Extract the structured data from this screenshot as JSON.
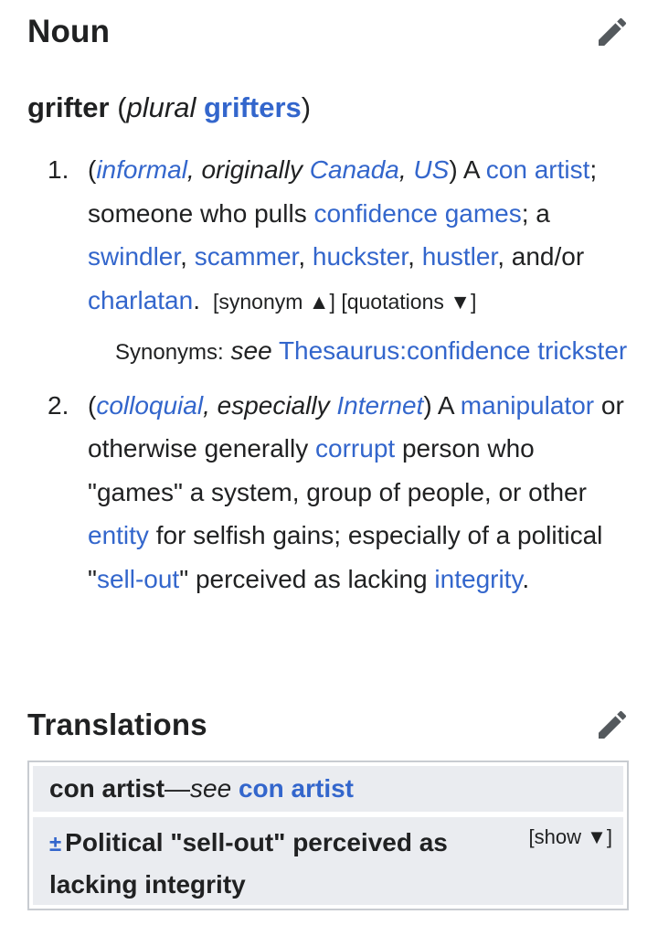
{
  "noun_heading": "Noun",
  "headword": {
    "word": "grifter",
    "open": " (",
    "plural_label": "plural",
    "plural_form": "grifters",
    "close": ")"
  },
  "senses": [
    {
      "number": "1.",
      "parts": [
        {
          "t": "("
        },
        {
          "t": "informal",
          "link": true,
          "italic": true
        },
        {
          "t": ", originally ",
          "italic": true
        },
        {
          "t": "Canada",
          "link": true,
          "italic": true
        },
        {
          "t": ", ",
          "italic": true
        },
        {
          "t": "US",
          "link": true,
          "italic": true
        },
        {
          "t": ") A "
        },
        {
          "t": "con artist",
          "link": true
        },
        {
          "t": "; someone who pulls "
        },
        {
          "t": "confidence games",
          "link": true
        },
        {
          "t": "; a "
        },
        {
          "t": "swindler",
          "link": true
        },
        {
          "t": ", "
        },
        {
          "t": "scammer",
          "link": true
        },
        {
          "t": ", "
        },
        {
          "t": "huckster",
          "link": true
        },
        {
          "t": ", "
        },
        {
          "t": "hustler",
          "link": true
        },
        {
          "t": ", and/or "
        },
        {
          "t": "charlatan",
          "link": true
        },
        {
          "t": "."
        }
      ],
      "synonym_toggle": "[synonym ▲]",
      "quotations_toggle": "[quotations ▼]",
      "synonyms_label": "Synonyms:",
      "synonyms_see": "see",
      "synonyms_link": "Thesaurus:confidence trickster"
    },
    {
      "number": "2.",
      "parts": [
        {
          "t": "("
        },
        {
          "t": "colloquial",
          "link": true,
          "italic": true
        },
        {
          "t": ", especially ",
          "italic": true
        },
        {
          "t": "Internet",
          "link": true,
          "italic": true
        },
        {
          "t": ") A "
        },
        {
          "t": "manipulator",
          "link": true
        },
        {
          "t": " or otherwise generally "
        },
        {
          "t": "corrupt",
          "link": true
        },
        {
          "t": " person who \"games\" a system, group of people, or other "
        },
        {
          "t": "entity",
          "link": true
        },
        {
          "t": " for selfish gains; especially of a political \""
        },
        {
          "t": "sell-out",
          "link": true
        },
        {
          "t": "\" perceived as lacking "
        },
        {
          "t": "integrity",
          "link": true
        },
        {
          "t": "."
        }
      ]
    }
  ],
  "translations_heading": "Translations",
  "translations": {
    "row1_term": "con artist",
    "row1_dash": " — ",
    "row1_see": "see",
    "row1_link": "con artist",
    "row2_marker": "±",
    "row2_title": "Political \"sell-out\" perceived as lacking integrity",
    "row2_toggle": "[show ▼]"
  },
  "icons": {
    "edit": "pencil-icon"
  },
  "colors": {
    "link": "#3366cc",
    "text": "#202122",
    "box_bg": "#eaecf0",
    "box_border": "#c8ccd1",
    "icon": "#54595d"
  }
}
